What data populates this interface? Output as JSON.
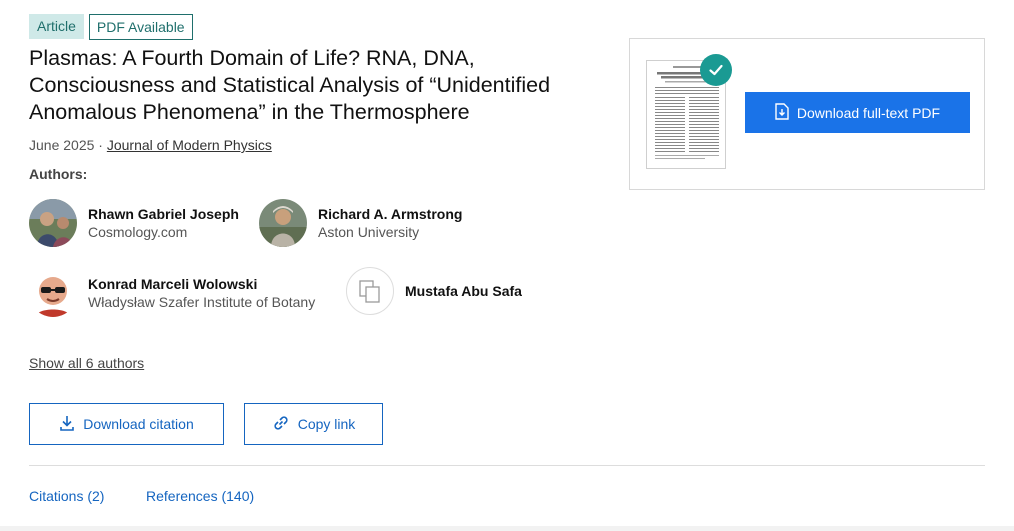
{
  "badges": {
    "article": "Article",
    "pdf_available": "PDF Available"
  },
  "publication": {
    "title": "Plasmas: A Fourth Domain of Life? RNA, DNA, Consciousness and Statistical Analysis of “Unidentified Anomalous Phenomena” in the Thermosphere",
    "date": "June 2025",
    "separator": " · ",
    "journal": "Journal of Modern Physics"
  },
  "authors_label": "Authors:",
  "authors": [
    {
      "name": "Rhawn Gabriel Joseph",
      "affiliation": "Cosmology.com"
    },
    {
      "name": "Richard A. Armstrong",
      "affiliation": "Aston University"
    },
    {
      "name": "Konrad Marceli Wolowski",
      "affiliation": "Władysław Szafer Institute of Botany"
    },
    {
      "name": "Mustafa Abu Safa",
      "affiliation": ""
    }
  ],
  "show_all_authors": "Show all 6 authors",
  "actions": {
    "download_citation": "Download citation",
    "copy_link": "Copy link"
  },
  "pdf_card": {
    "download_button": "Download full-text PDF"
  },
  "tabs": [
    {
      "label": "Citations (2)"
    },
    {
      "label": "References (140)"
    }
  ],
  "colors": {
    "accent_blue": "#1a73e8",
    "link_blue": "#1565c0",
    "teal": "#1a9a93",
    "badge_bg": "#cfe9e8"
  },
  "icons": [
    "download-icon",
    "link-icon",
    "pdf-download-icon",
    "check-icon",
    "placeholder-avatar-icon"
  ]
}
